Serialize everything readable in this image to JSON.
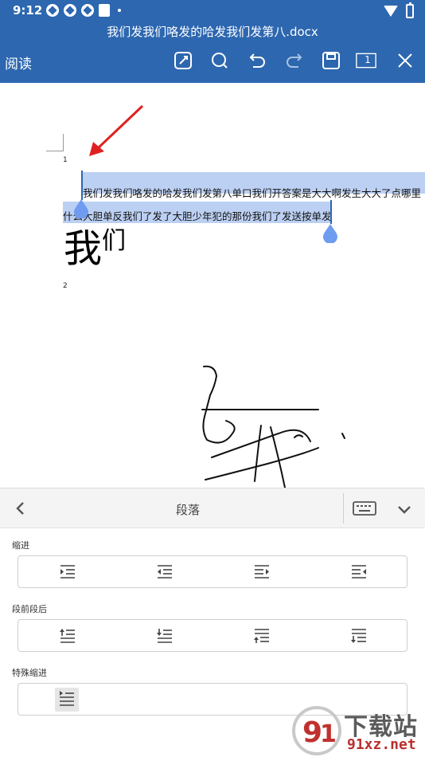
{
  "status_bar": {
    "time": "9:12"
  },
  "app_bar": {
    "title": "我们发我们咯发的哈发我们发第八.docx",
    "mode_label": "阅读",
    "page_indicator": "1",
    "icons": [
      "edit-icon",
      "search-icon",
      "undo-icon",
      "redo-icon",
      "save-icon",
      "page-view-icon",
      "close-icon"
    ]
  },
  "document": {
    "page_number_1": "1",
    "page_number_2": "2",
    "selected_line_1": "我们发我们咯发的哈发我们发第八单口我们开答案是大大啊发生大大了点哪里",
    "selected_line_2": "什么大胆单反我们了发了大胆少年犯的那份我们了发送按单发",
    "big_char": "我",
    "small_chars": "们",
    "selection_color": "#bcd0f3"
  },
  "panel": {
    "title": "段落",
    "sections": [
      {
        "label": "缩进",
        "buttons": [
          "increase-indent-icon",
          "decrease-indent-icon",
          "indent-right-icon",
          "indent-left-icon"
        ]
      },
      {
        "label": "段前段后",
        "buttons": [
          "space-before-icon",
          "space-after-icon",
          "remove-space-before-icon",
          "remove-space-after-icon"
        ]
      },
      {
        "label": "特殊缩进",
        "buttons": [
          "first-line-indent-icon"
        ]
      }
    ]
  },
  "watermark": {
    "name": "下载站",
    "url": "91xz.net"
  },
  "colors": {
    "brand": "#2d67b0",
    "annotation_arrow": "#e02020",
    "watermark_red": "#b9302e"
  }
}
